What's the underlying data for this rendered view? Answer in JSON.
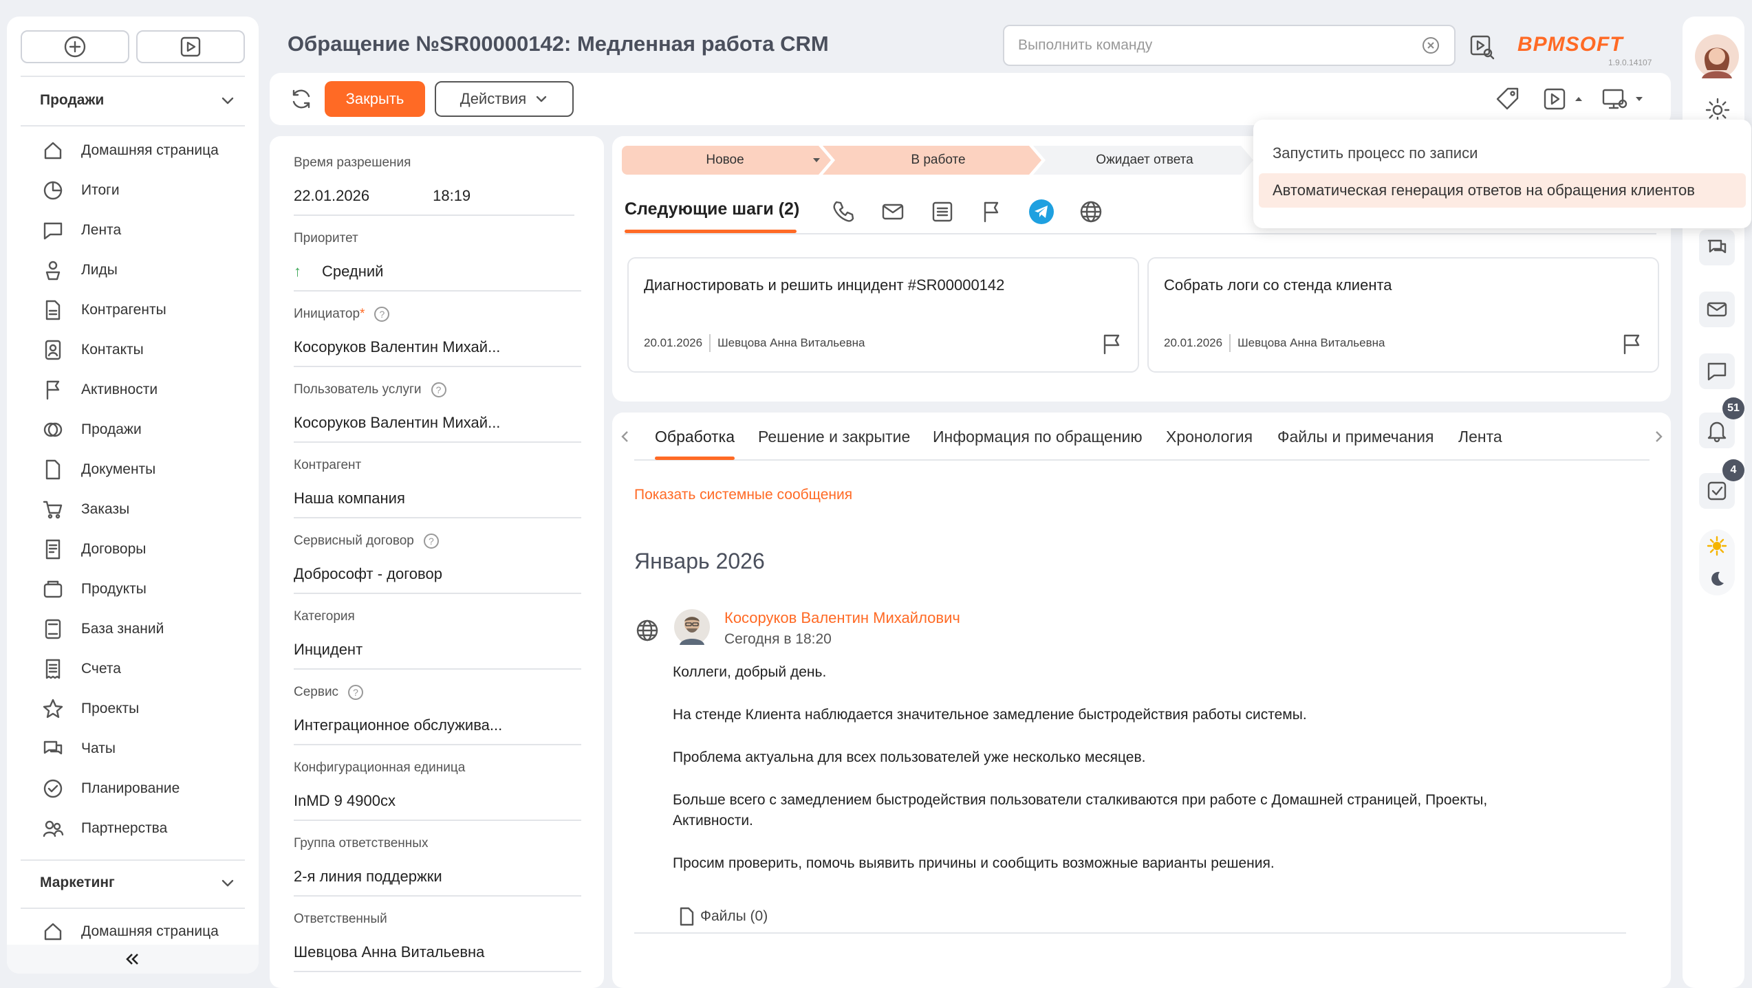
{
  "sidebar": {
    "sections": [
      {
        "label": "Продажи"
      },
      {
        "label": "Маркетинг"
      }
    ],
    "items": [
      {
        "label": "Домашняя страница",
        "icon": "home-icon"
      },
      {
        "label": "Итоги",
        "icon": "pie-chart-icon"
      },
      {
        "label": "Лента",
        "icon": "chat-bubble-icon"
      },
      {
        "label": "Лиды",
        "icon": "lead-icon"
      },
      {
        "label": "Контрагенты",
        "icon": "document-icon"
      },
      {
        "label": "Контакты",
        "icon": "contact-icon"
      },
      {
        "label": "Активности",
        "icon": "flag-icon"
      },
      {
        "label": "Продажи",
        "icon": "sales-icon"
      },
      {
        "label": "Документы",
        "icon": "file-icon"
      },
      {
        "label": "Заказы",
        "icon": "cart-icon"
      },
      {
        "label": "Договоры",
        "icon": "contract-icon"
      },
      {
        "label": "Продукты",
        "icon": "box-icon"
      },
      {
        "label": "База знаний",
        "icon": "book-icon"
      },
      {
        "label": "Счета",
        "icon": "invoice-icon"
      },
      {
        "label": "Проекты",
        "icon": "star-icon"
      },
      {
        "label": "Чаты",
        "icon": "chats-icon"
      },
      {
        "label": "Планирование",
        "icon": "check-circle-icon"
      },
      {
        "label": "Партнерства",
        "icon": "partners-icon"
      }
    ],
    "marketing_items": [
      {
        "label": "Домашняя страница",
        "icon": "home-icon"
      }
    ]
  },
  "header": {
    "title": "Обращение №SR00000142: Медленная работа CRM",
    "command_placeholder": "Выполнить команду",
    "logo": "BPMSOFT",
    "version": "1.9.0.14107"
  },
  "toolbar": {
    "close_label": "Закрыть",
    "actions_label": "Действия"
  },
  "fields": [
    {
      "label": "Время разрешения",
      "value": "22.01.2026",
      "value2": "18:19",
      "link": false
    },
    {
      "label": "Приоритет",
      "value": "Средний",
      "link": false
    },
    {
      "label": "Инициатор",
      "required": "*",
      "value": "Косоруков Валентин Михай...",
      "link": true
    },
    {
      "label": "Пользователь услуги",
      "value": "Косоруков Валентин Михай...",
      "link": true
    },
    {
      "label": "Контрагент",
      "value": "Наша компания",
      "link": true
    },
    {
      "label": "Сервисный договор",
      "value": "Добрософт - договор",
      "link": false
    },
    {
      "label": "Категория",
      "value": "Инцидент",
      "link": false
    },
    {
      "label": "Сервис",
      "value": "Интеграционное обслужива...",
      "link": true
    },
    {
      "label": "Конфигурационная единица",
      "value": "InMD 9 4900cx",
      "link": true
    },
    {
      "label": "Группа ответственных",
      "value": "2-я линия поддержки",
      "link": true
    },
    {
      "label": "Ответственный",
      "value": "Шевцова Анна Витальевна",
      "link": true
    }
  ],
  "stages": [
    {
      "label": "Новое",
      "state": "done"
    },
    {
      "label": "В работе",
      "state": "current"
    },
    {
      "label": "Ожидает ответа",
      "state": "future"
    }
  ],
  "next_steps": {
    "title": "Следующие шаги (2)",
    "tasks": [
      {
        "title": "Диагностировать и решить инцидент #SR00000142",
        "date": "20.01.2026",
        "owner": "Шевцова Анна Витальевна"
      },
      {
        "title": "Собрать логи со стенда клиента",
        "date": "20.01.2026",
        "owner": "Шевцова Анна Витальевна"
      }
    ]
  },
  "tabs": [
    {
      "label": "Обработка",
      "active": true
    },
    {
      "label": "Решение и закрытие"
    },
    {
      "label": "Информация по обращению"
    },
    {
      "label": "Хронология"
    },
    {
      "label": "Файлы и примечания"
    },
    {
      "label": "Лента"
    }
  ],
  "feed": {
    "show_system": "Показать системные сообщения",
    "month": "Январь 2026",
    "author": "Косоруков Валентин Михайлович",
    "time": "Сегодня в 18:20",
    "lines": [
      "Коллеги, добрый день.",
      "На стенде Клиента наблюдается значительное замедление быстродействия работы системы.",
      "Проблема актуальна для всех пользователей уже несколько месяцев.",
      "Больше всего с замедлением быстродействия пользователи сталкиваются при работе с  Домашней страницей, Проекты,",
      "Активности.",
      "Просим проверить, помочь выявить причины  и сообщить возможные варианты решения."
    ],
    "files": "Файлы (0)"
  },
  "dropdown": {
    "items": [
      "Запустить процесс по записи",
      "Автоматическая генерация ответов на обращения клиентов"
    ]
  },
  "right_rail": {
    "notifications_count": "51",
    "tasks_count": "4"
  },
  "colors": {
    "accent": "#ff6a25",
    "stage_done": "#fcd2c0",
    "link": "#ff6a25"
  }
}
